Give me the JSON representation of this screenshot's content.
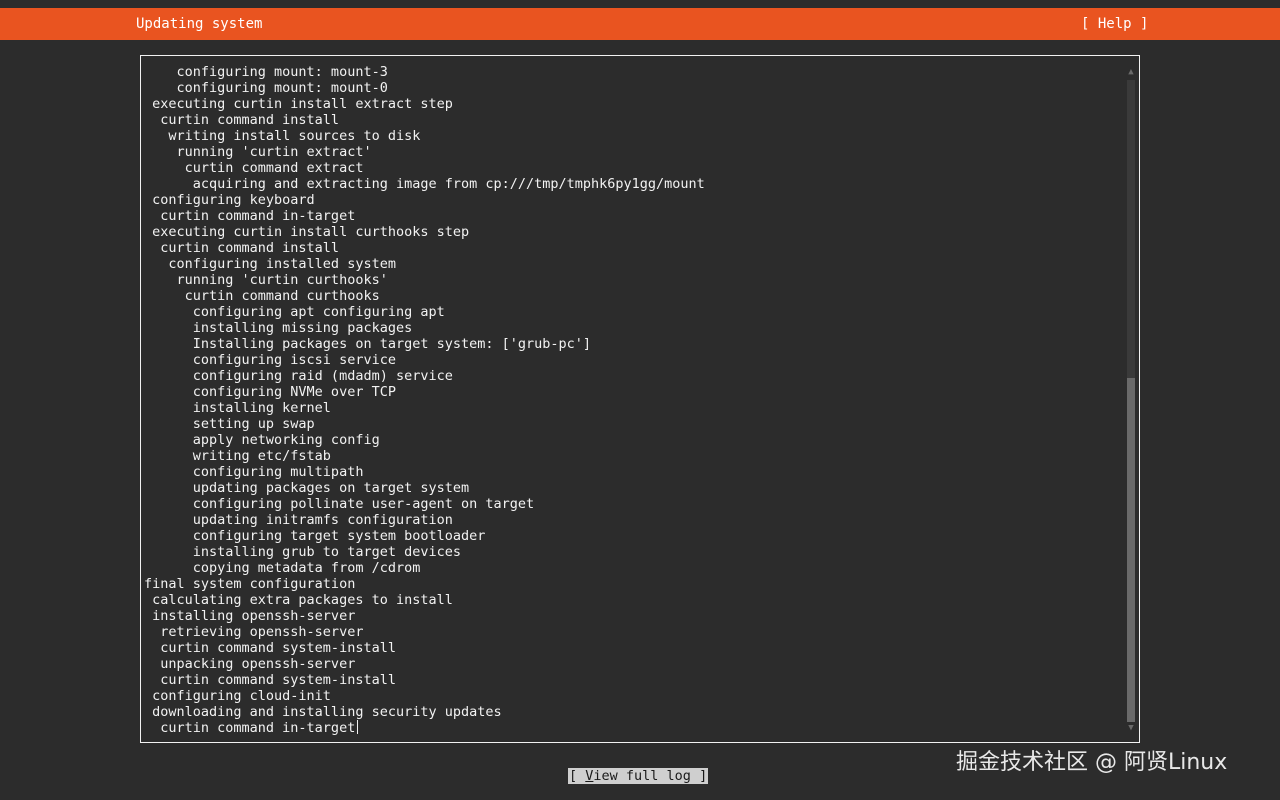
{
  "header": {
    "title": "Updating system",
    "help_label": "[ Help ]"
  },
  "log": {
    "lines": [
      "    configuring mount: mount-3",
      "    configuring mount: mount-0",
      " executing curtin install extract step",
      "  curtin command install",
      "   writing install sources to disk",
      "    running 'curtin extract'",
      "     curtin command extract",
      "      acquiring and extracting image from cp:///tmp/tmphk6py1gg/mount",
      " configuring keyboard",
      "  curtin command in-target",
      " executing curtin install curthooks step",
      "  curtin command install",
      "   configuring installed system",
      "    running 'curtin curthooks'",
      "     curtin command curthooks",
      "      configuring apt configuring apt",
      "      installing missing packages",
      "      Installing packages on target system: ['grub-pc']",
      "      configuring iscsi service",
      "      configuring raid (mdadm) service",
      "      configuring NVMe over TCP",
      "      installing kernel",
      "      setting up swap",
      "      apply networking config",
      "      writing etc/fstab",
      "      configuring multipath",
      "      updating packages on target system",
      "      configuring pollinate user-agent on target",
      "      updating initramfs configuration",
      "      configuring target system bootloader",
      "      installing grub to target devices",
      "      copying metadata from /cdrom",
      "final system configuration",
      " calculating extra packages to install",
      " installing openssh-server",
      "  retrieving openssh-server",
      "  curtin command system-install",
      "  unpacking openssh-server",
      "  curtin command system-install",
      " configuring cloud-init",
      " downloading and installing security updates",
      "  curtin command in-target"
    ],
    "scroll": {
      "up_arrow_icon": "triangle-up",
      "down_arrow_icon": "triangle-down"
    }
  },
  "footer": {
    "view_log_prefix": "[ ",
    "view_log_accel": "V",
    "view_log_rest": "iew full log ]"
  },
  "watermark": {
    "text": "掘金技术社区 @ 阿贤Linux"
  },
  "colors": {
    "header_bg": "#e95420",
    "background": "#2c2c2c",
    "text": "#f2f2f2",
    "button_bg": "#cfcfcf"
  }
}
